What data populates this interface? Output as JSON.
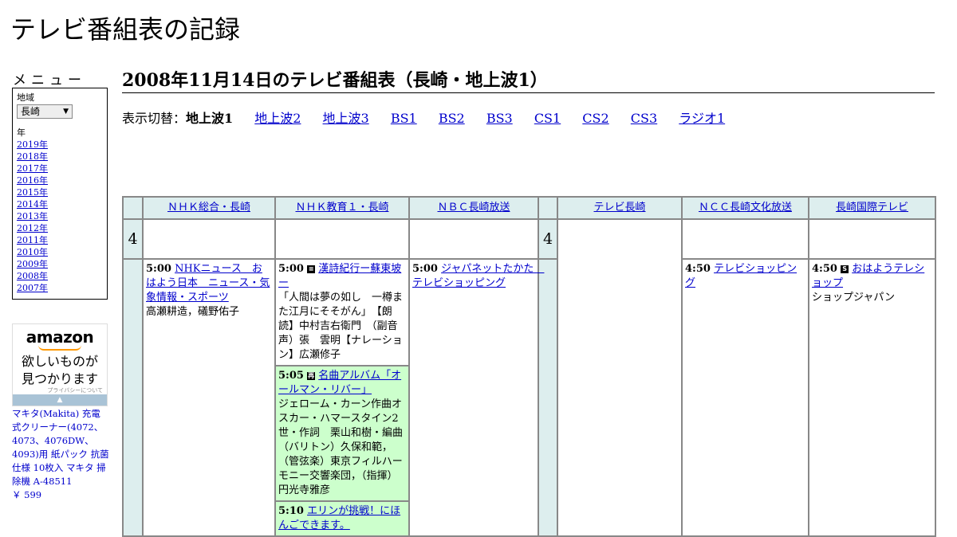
{
  "site": {
    "title": "テレビ番組表の記録"
  },
  "menu": {
    "heading": "メニュー",
    "region_label": "地域",
    "region_value": "長崎",
    "year_label": "年",
    "years": [
      "2019年",
      "2018年",
      "2017年",
      "2016年",
      "2015年",
      "2014年",
      "2013年",
      "2012年",
      "2011年",
      "2010年",
      "2009年",
      "2008年",
      "2007年"
    ]
  },
  "ad": {
    "logo": "amazon",
    "slogan_line1": "欲しいものが",
    "slogan_line2": "見つかります",
    "privacy": "プライバシーについて",
    "product": "マキタ(Makita) 充電式クリーナー(4072、4073、4076DW、4093)用 紙パック 抗菌仕様 10枚入 マキタ 掃除機 A-48511",
    "price": "￥ 599"
  },
  "page": {
    "heading": "2008年11月14日のテレビ番組表（長崎・地上波1）",
    "switch_label": "表示切替：",
    "switch_current": "地上波1",
    "switch_links": [
      "地上波2",
      "地上波3",
      "BS1",
      "BS2",
      "BS3",
      "CS1",
      "CS2",
      "CS3",
      "ラジオ1"
    ]
  },
  "schedule": {
    "channels": [
      "ＮＨＫ総合・長崎",
      "ＮＨＫ教育１・長崎",
      "ＮＢＣ長崎放送",
      "テレビ長崎",
      "ＮＣＣ長崎文化放送",
      "長崎国際テレビ"
    ],
    "hour": "4",
    "programs": {
      "nhk_sogo": {
        "time": "5:00",
        "title": "NHKニュース　おはよう日本　ニュース・気象情報・スポーツ",
        "desc": "高瀬耕造，礒野佑子"
      },
      "nhk_edu_1": {
        "time": "5:00",
        "title": "漢詩紀行ー蘇東坡ー",
        "desc": "「人間は夢の如し　一樽また江月にそそがん」　【朗読】中村吉右衛門　（副音声）張　雲明【ナレーション】広瀬修子"
      },
      "nhk_edu_2": {
        "time": "5:05",
        "title": "名曲アルバム「オールマン・リバー」",
        "desc": "ジェローム・カーン作曲オスカー・ハマースタイン2世・作詞　栗山和樹・編曲（バリトン）久保和範，（管弦楽）東京フィルハーモニー交響楽団，（指揮）円光寺雅彦"
      },
      "nhk_edu_3": {
        "time": "5:10",
        "title": "エリンが挑戦！にほんごできます。"
      },
      "nbc": {
        "time": "5:00",
        "title": "ジャパネットたかた　テレビショッピング"
      },
      "ncc": {
        "time": "4:50",
        "title": "テレビショッピング"
      },
      "nib": {
        "time": "4:50",
        "title": "おはようテレショップ",
        "desc": "ショップジャパン"
      }
    }
  }
}
